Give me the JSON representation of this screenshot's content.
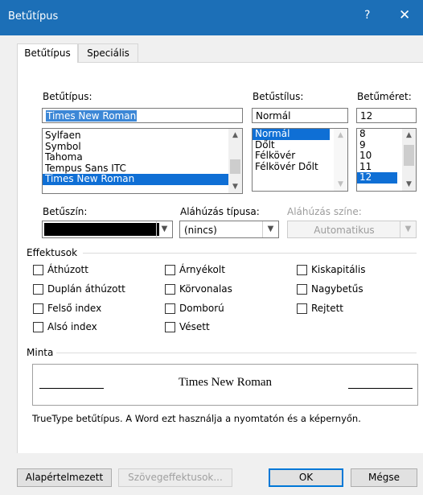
{
  "window": {
    "title": "Betűtípus",
    "help": "?",
    "close": "✕"
  },
  "tabs": [
    {
      "label": "Betűtípus",
      "active": true
    },
    {
      "label": "Speciális",
      "active": false
    }
  ],
  "font": {
    "label": "Betűtípus:",
    "value": "Times New Roman",
    "items": [
      "Sylfaen",
      "Symbol",
      "Tahoma",
      "Tempus Sans ITC",
      "Times New Roman"
    ],
    "selected_index": 4
  },
  "style": {
    "label": "Betűstílus:",
    "value": "Normál",
    "items": [
      "Normál",
      "Dőlt",
      "Félkövér",
      "Félkövér Dőlt"
    ],
    "selected_index": 0
  },
  "size": {
    "label": "Betűméret:",
    "value": "12",
    "items": [
      "8",
      "9",
      "10",
      "11",
      "12"
    ],
    "selected_index": 4
  },
  "font_color": {
    "label": "Betűszín:",
    "value": "#000000"
  },
  "underline_style": {
    "label": "Aláhúzás típusa:",
    "value": "(nincs)"
  },
  "underline_color": {
    "label": "Aláhúzás színe:",
    "value": "Automatikus"
  },
  "effects": {
    "title": "Effektusok",
    "items": [
      {
        "label": "Áthúzott",
        "checked": false
      },
      {
        "label": "Duplán áthúzott",
        "checked": false
      },
      {
        "label": "Felső index",
        "checked": false
      },
      {
        "label": "Alsó index",
        "checked": false
      },
      {
        "label": "Árnyékolt",
        "checked": false
      },
      {
        "label": "Körvonalas",
        "checked": false
      },
      {
        "label": "Domború",
        "checked": false
      },
      {
        "label": "Vésett",
        "checked": false
      },
      {
        "label": "Kiskapitális",
        "checked": false
      },
      {
        "label": "Nagybetűs",
        "checked": false
      },
      {
        "label": "Rejtett",
        "checked": false
      }
    ]
  },
  "preview": {
    "title": "Minta",
    "text": "Times New Roman",
    "description": "TrueType betűtípus. A Word ezt használja a nyomtatón és a képernyőn."
  },
  "buttons": {
    "default": "Alapértelmezett",
    "text_effects": "Szövegeffektusok...",
    "ok": "OK",
    "cancel": "Mégse"
  },
  "icons": {
    "dropdown": "chevron-down-icon",
    "scroll_up": "chevron-up-icon",
    "scroll_down": "chevron-down-icon"
  }
}
